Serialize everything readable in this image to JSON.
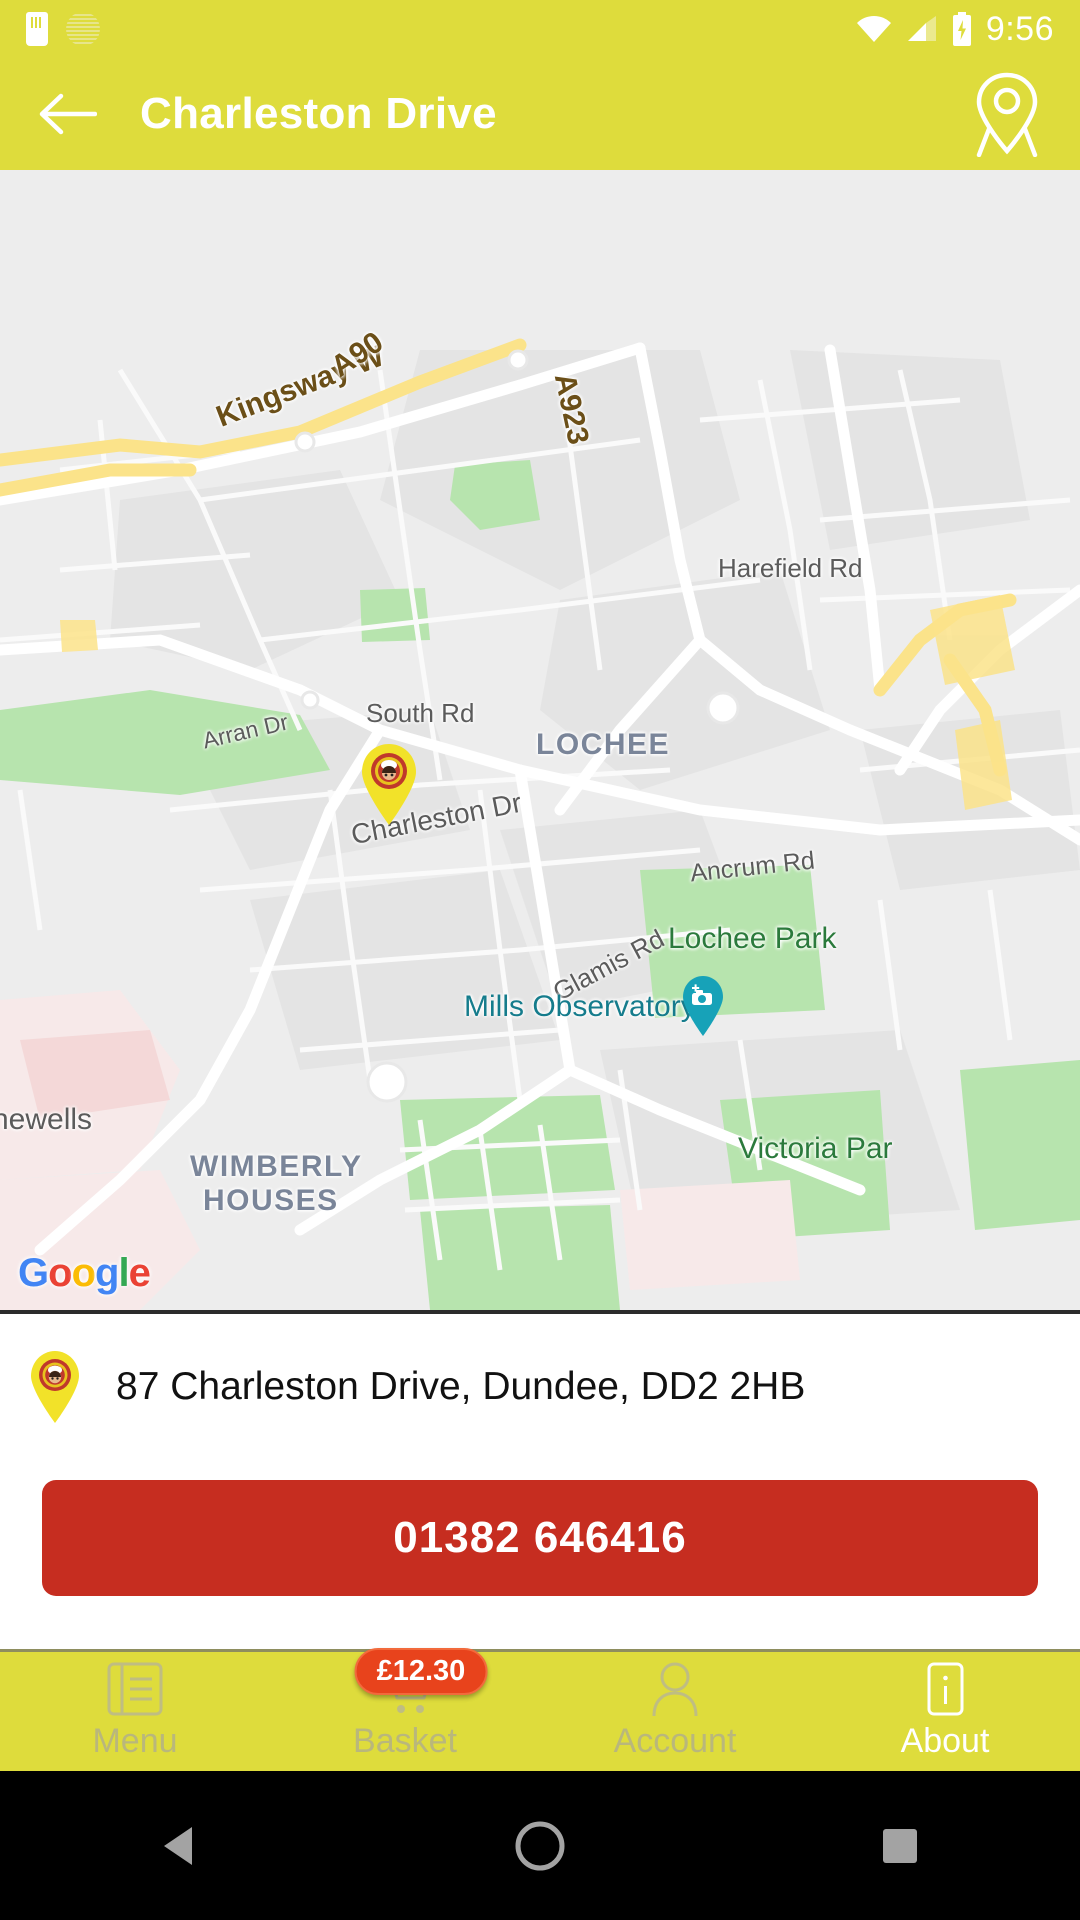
{
  "status_bar": {
    "time": "9:56",
    "icons": [
      "sim-card-icon",
      "sync-circle-icon",
      "wifi-icon",
      "cellular-signal-icon",
      "battery-charging-icon"
    ]
  },
  "app_bar": {
    "back_icon": "back-arrow-icon",
    "title": "Charleston Drive",
    "action_icon": "map-pin-icon"
  },
  "map": {
    "attribution": "Google",
    "attribution_letters": [
      "G",
      "o",
      "o",
      "g",
      "l",
      "e"
    ],
    "store_marker_name": "store-location-marker",
    "labels": [
      {
        "text": "Kingsway W",
        "type": "highway"
      },
      {
        "text": "A90",
        "type": "highway"
      },
      {
        "text": "A923",
        "type": "highway"
      },
      {
        "text": "Harefield Rd",
        "type": "road"
      },
      {
        "text": "South Rd",
        "type": "road"
      },
      {
        "text": "LOCHEE",
        "type": "place"
      },
      {
        "text": "Arran Dr",
        "type": "road"
      },
      {
        "text": "Charleston Dr",
        "type": "road"
      },
      {
        "text": "Ancrum Rd",
        "type": "road"
      },
      {
        "text": "Lochee Park",
        "type": "park"
      },
      {
        "text": "Glamis Rd",
        "type": "road"
      },
      {
        "text": "Mills Observatory",
        "type": "poi"
      },
      {
        "text": "hewells",
        "type": "road"
      },
      {
        "text": "WIMBERLY",
        "type": "place"
      },
      {
        "text": "HOUSES",
        "type": "place"
      },
      {
        "text": "Victoria Par",
        "type": "park"
      }
    ]
  },
  "info": {
    "address": "87 Charleston Drive, Dundee, DD2 2HB",
    "address_pin_icon": "store-pin-icon",
    "phone_number": "01382 646416"
  },
  "tab_bar": {
    "tabs": [
      {
        "label": "Menu",
        "icon": "menu-book-icon",
        "active": false
      },
      {
        "label": "Basket",
        "icon": "shopping-cart-icon",
        "active": false,
        "badge": "£12.30"
      },
      {
        "label": "Account",
        "icon": "person-icon",
        "active": false
      },
      {
        "label": "About",
        "icon": "info-icon",
        "active": true
      }
    ]
  },
  "android_nav": {
    "back": "nav-back-triangle-icon",
    "home": "nav-home-circle-icon",
    "recents": "nav-recents-square-icon"
  },
  "colors": {
    "brand_yellow": "#DEDC3C",
    "call_red": "#C62D20",
    "badge_red": "#E8431C",
    "map_bg": "#EDEDED",
    "park_green": "#ADE3A4"
  }
}
